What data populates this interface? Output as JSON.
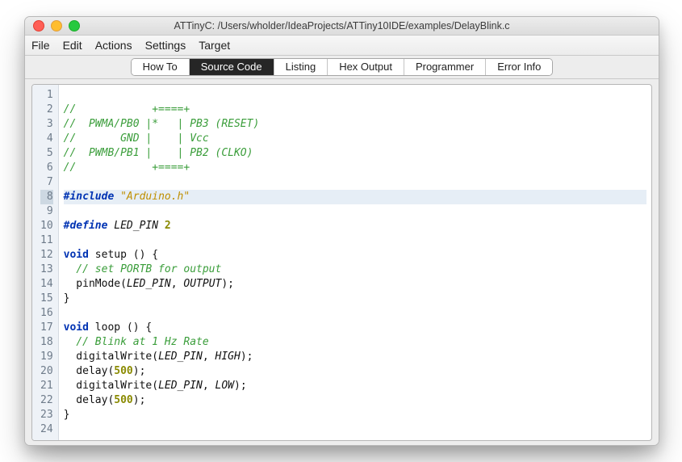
{
  "window": {
    "title": "ATTinyC: /Users/wholder/IdeaProjects/ATTiny10IDE/examples/DelayBlink.c"
  },
  "menu": {
    "items": [
      "File",
      "Edit",
      "Actions",
      "Settings",
      "Target"
    ]
  },
  "tabs": {
    "items": [
      "How To",
      "Source Code",
      "Listing",
      "Hex Output",
      "Programmer",
      "Error Info"
    ],
    "active_index": 1
  },
  "editor": {
    "current_line": 8,
    "lines": [
      {
        "num": 1,
        "segs": []
      },
      {
        "num": 2,
        "segs": [
          {
            "cls": "c-comment",
            "text": "//            +====+"
          }
        ]
      },
      {
        "num": 3,
        "segs": [
          {
            "cls": "c-comment",
            "text": "//  PWMA/PB0 |*   | PB3 (RESET)"
          }
        ]
      },
      {
        "num": 4,
        "segs": [
          {
            "cls": "c-comment",
            "text": "//       GND |    | Vcc"
          }
        ]
      },
      {
        "num": 5,
        "segs": [
          {
            "cls": "c-comment",
            "text": "//  PWMB/PB1 |    | PB2 (CLKO)"
          }
        ]
      },
      {
        "num": 6,
        "segs": [
          {
            "cls": "c-comment",
            "text": "//            +====+"
          }
        ]
      },
      {
        "num": 7,
        "segs": []
      },
      {
        "num": 8,
        "segs": [
          {
            "cls": "c-prep",
            "text": "#include"
          },
          {
            "cls": "",
            "text": " "
          },
          {
            "cls": "c-string",
            "text": "\"Arduino.h\""
          }
        ]
      },
      {
        "num": 9,
        "segs": []
      },
      {
        "num": 10,
        "segs": [
          {
            "cls": "c-prep",
            "text": "#define"
          },
          {
            "cls": "",
            "text": " "
          },
          {
            "cls": "c-macro",
            "text": "LED_PIN"
          },
          {
            "cls": "",
            "text": " "
          },
          {
            "cls": "c-num",
            "text": "2"
          }
        ]
      },
      {
        "num": 11,
        "segs": []
      },
      {
        "num": 12,
        "segs": [
          {
            "cls": "c-keyword",
            "text": "void"
          },
          {
            "cls": "",
            "text": " setup () {"
          }
        ]
      },
      {
        "num": 13,
        "segs": [
          {
            "cls": "",
            "text": "  "
          },
          {
            "cls": "c-comment",
            "text": "// set PORTB for output"
          }
        ]
      },
      {
        "num": 14,
        "segs": [
          {
            "cls": "",
            "text": "  pinMode("
          },
          {
            "cls": "c-const",
            "text": "LED_PIN"
          },
          {
            "cls": "",
            "text": ", "
          },
          {
            "cls": "c-const",
            "text": "OUTPUT"
          },
          {
            "cls": "",
            "text": ");"
          }
        ]
      },
      {
        "num": 15,
        "segs": [
          {
            "cls": "",
            "text": "}"
          }
        ]
      },
      {
        "num": 16,
        "segs": []
      },
      {
        "num": 17,
        "segs": [
          {
            "cls": "c-keyword",
            "text": "void"
          },
          {
            "cls": "",
            "text": " loop () {"
          }
        ]
      },
      {
        "num": 18,
        "segs": [
          {
            "cls": "",
            "text": "  "
          },
          {
            "cls": "c-comment",
            "text": "// Blink at 1 Hz Rate"
          }
        ]
      },
      {
        "num": 19,
        "segs": [
          {
            "cls": "",
            "text": "  digitalWrite("
          },
          {
            "cls": "c-const",
            "text": "LED_PIN"
          },
          {
            "cls": "",
            "text": ", "
          },
          {
            "cls": "c-const",
            "text": "HIGH"
          },
          {
            "cls": "",
            "text": ");"
          }
        ]
      },
      {
        "num": 20,
        "segs": [
          {
            "cls": "",
            "text": "  delay("
          },
          {
            "cls": "c-num",
            "text": "500"
          },
          {
            "cls": "",
            "text": ");"
          }
        ]
      },
      {
        "num": 21,
        "segs": [
          {
            "cls": "",
            "text": "  digitalWrite("
          },
          {
            "cls": "c-const",
            "text": "LED_PIN"
          },
          {
            "cls": "",
            "text": ", "
          },
          {
            "cls": "c-const",
            "text": "LOW"
          },
          {
            "cls": "",
            "text": ");"
          }
        ]
      },
      {
        "num": 22,
        "segs": [
          {
            "cls": "",
            "text": "  delay("
          },
          {
            "cls": "c-num",
            "text": "500"
          },
          {
            "cls": "",
            "text": ");"
          }
        ]
      },
      {
        "num": 23,
        "segs": [
          {
            "cls": "",
            "text": "}"
          }
        ]
      },
      {
        "num": 24,
        "segs": []
      }
    ]
  }
}
